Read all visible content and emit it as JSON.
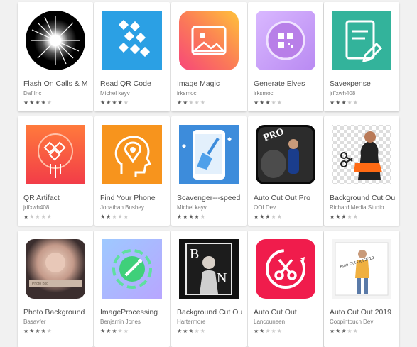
{
  "apps": [
    {
      "title": "Flash On Calls & M",
      "developer": "Daf Inc",
      "rating": 4,
      "icon": "flash-burst-icon"
    },
    {
      "title": "Read QR Code",
      "developer": "Michel kayv",
      "rating": 4,
      "icon": "qr-code-icon"
    },
    {
      "title": "Image Magic",
      "developer": "irksmoc",
      "rating": 2,
      "icon": "landscape-image-icon"
    },
    {
      "title": "Generate Elves",
      "developer": "irksmoc",
      "rating": 3,
      "icon": "qr-glow-icon"
    },
    {
      "title": "Savexpense",
      "developer": "jrffxwh408",
      "rating": 3,
      "icon": "notepad-pen-icon"
    },
    {
      "title": "QR Artifact",
      "developer": "jrffxwh408",
      "rating": 1,
      "icon": "qr-rocket-icon"
    },
    {
      "title": "Find Your Phone",
      "developer": "Jonathan Bushey",
      "rating": 2,
      "icon": "head-location-icon"
    },
    {
      "title": "Scavenger---speed",
      "developer": "Michel kayv",
      "rating": 4,
      "icon": "phone-broom-icon"
    },
    {
      "title": "Auto Cut Out Pro",
      "developer": "OOI Dev",
      "rating": 3,
      "icon": "photo-cutout-pro-icon"
    },
    {
      "title": "Background Cut Ou",
      "developer": "Richard Media Studio",
      "rating": 3,
      "icon": "scissors-cutout-icon"
    },
    {
      "title": "Photo Background",
      "developer": "Basavfer",
      "rating": 4,
      "icon": "portrait-blur-icon"
    },
    {
      "title": "ImageProcessing",
      "developer": "Benjamin Jones",
      "rating": 3,
      "icon": "magic-wand-icon"
    },
    {
      "title": "Background Cut Ou",
      "developer": "Hartermore",
      "rating": 3,
      "icon": "black-white-photo-icon"
    },
    {
      "title": "Auto Cut Out",
      "developer": "Lancouneen",
      "rating": 2,
      "icon": "scissors-circle-icon"
    },
    {
      "title": "Auto Cut Out 2019",
      "developer": "Coopintouch Dev",
      "rating": 3,
      "icon": "fashion-photo-icon"
    }
  ]
}
